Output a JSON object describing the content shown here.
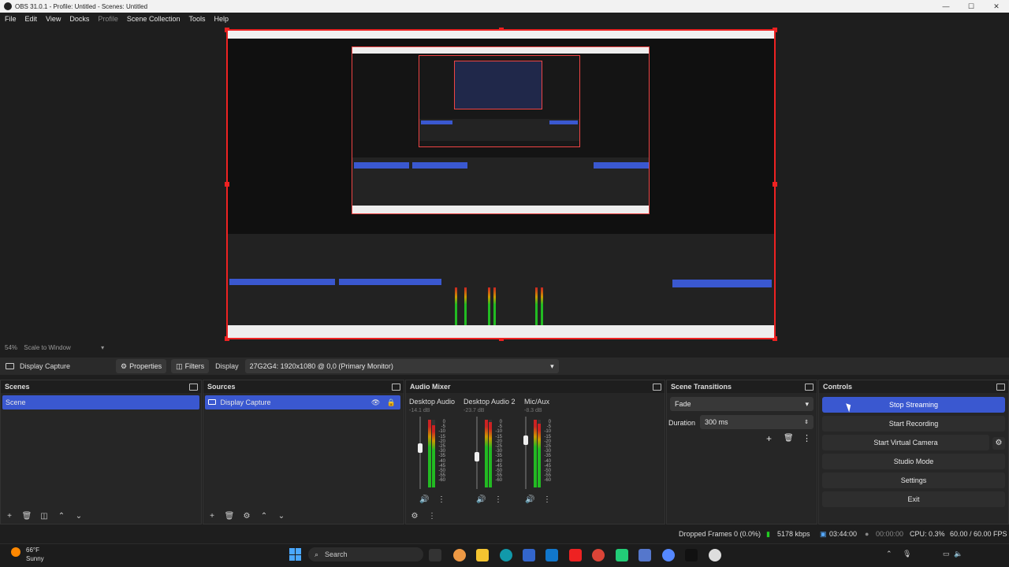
{
  "window": {
    "title": "OBS 31.0.1 - Profile: Untitled - Scenes: Untitled",
    "controls": [
      "—",
      "☐",
      "✕"
    ]
  },
  "menu": [
    "File",
    "Edit",
    "View",
    "Docks",
    "Profile",
    "Scene Collection",
    "Tools",
    "Help"
  ],
  "preview": {
    "zoom": "54%",
    "scale_mode": "Scale to Window"
  },
  "source_toolbar": {
    "source_name": "Display Capture",
    "properties": "Properties",
    "filters": "Filters",
    "display_label": "Display",
    "display_value": "27G2G4: 1920x1080 @ 0,0 (Primary Monitor)"
  },
  "scenes": {
    "title": "Scenes",
    "items": [
      "Scene"
    ]
  },
  "sources": {
    "title": "Sources",
    "items": [
      "Display Capture"
    ]
  },
  "audio_mixer": {
    "title": "Audio Mixer",
    "channels": [
      {
        "name": "Desktop Audio",
        "db": "-14.1 dB"
      },
      {
        "name": "Desktop Audio 2",
        "db": "-23.7 dB"
      },
      {
        "name": "Mic/Aux",
        "db": "-8.3 dB"
      }
    ],
    "scale": [
      "0",
      "-5",
      "-10",
      "-15",
      "-20",
      "-25",
      "-30",
      "-35",
      "-40",
      "-45",
      "-50",
      "-55",
      "-60"
    ]
  },
  "scene_transitions": {
    "title": "Scene Transitions",
    "transition": "Fade",
    "duration_label": "Duration",
    "duration_value": "300 ms"
  },
  "controls": {
    "title": "Controls",
    "stop_streaming": "Stop Streaming",
    "start_recording": "Start Recording",
    "start_virtual_camera": "Start Virtual Camera",
    "studio_mode": "Studio Mode",
    "settings": "Settings",
    "exit": "Exit"
  },
  "status": {
    "dropped_frames": "Dropped Frames 0 (0.0%)",
    "bitrate": "5178 kbps",
    "stream_time": "03:44:00",
    "record_time": "00:00:00",
    "cpu": "CPU: 0.3%",
    "fps": "60.00 / 60.00 FPS"
  },
  "taskbar": {
    "weather_temp": "66°F",
    "weather_desc": "Sunny",
    "search": "Search"
  },
  "colors": {
    "accent": "#3a58d0",
    "selection_border": "#e22222",
    "background": "#1e1e1e"
  }
}
